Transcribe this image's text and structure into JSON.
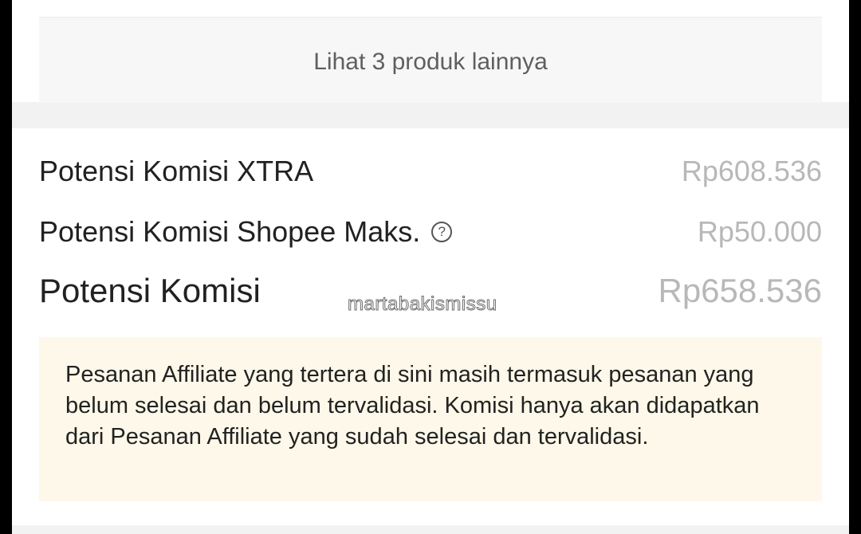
{
  "more_products": {
    "label": "Lihat 3 produk lainnya"
  },
  "commission": {
    "xtra": {
      "label": "Potensi Komisi XTRA",
      "value": "Rp608.536"
    },
    "shopee_max": {
      "label": "Potensi Komisi Shopee Maks.",
      "value": "Rp50.000",
      "icon": "help-circle-icon"
    },
    "total": {
      "label": "Potensi Komisi",
      "value": "Rp658.536"
    }
  },
  "notice": {
    "text": "Pesanan Affiliate yang tertera di sini masih termasuk pesanan yang belum selesai dan belum tervalidasi. Komisi hanya akan didapatkan dari Pesanan Affiliate yang sudah selesai dan tervalidasi."
  },
  "watermark": {
    "text": "martabakismissu"
  }
}
